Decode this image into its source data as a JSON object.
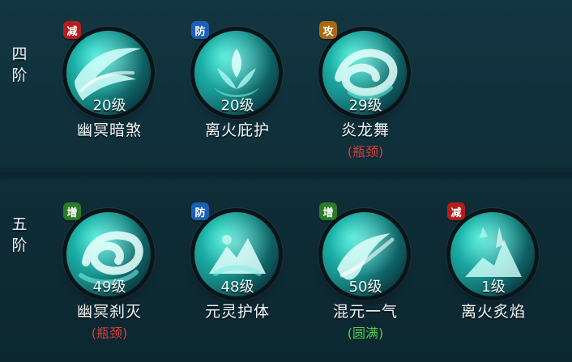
{
  "tiers": [
    {
      "label_lines": [
        "四",
        "阶"
      ]
    },
    {
      "label_lines": [
        "五",
        "阶"
      ]
    }
  ],
  "rows": [
    {
      "skills": [
        {
          "badge": "减",
          "badge_color": "#b51d1d",
          "level": "20级",
          "name": "幽冥暗煞",
          "tag": "",
          "tag_color": "",
          "icon": "swoosh-icon"
        },
        {
          "badge": "防",
          "badge_color": "#1b5fb6",
          "level": "20级",
          "name": "离火庇护",
          "tag": "",
          "tag_color": "",
          "icon": "lotus-icon"
        },
        {
          "badge": "攻",
          "badge_color": "#a86a11",
          "level": "29级",
          "name": "炎龙舞",
          "tag": "(瓶颈)",
          "tag_color": "#d24545",
          "icon": "vortex-icon"
        }
      ]
    },
    {
      "skills": [
        {
          "badge": "增",
          "badge_color": "#2a7b2a",
          "level": "49级",
          "name": "幽冥刹灭",
          "tag": "(瓶颈)",
          "tag_color": "#d24545",
          "icon": "swirl-icon"
        },
        {
          "badge": "防",
          "badge_color": "#1b5fb6",
          "level": "48级",
          "name": "元灵护体",
          "tag": "",
          "tag_color": "",
          "icon": "mountain-icon"
        },
        {
          "badge": "增",
          "badge_color": "#2a7b2a",
          "level": "50级",
          "name": "混元一气",
          "tag": "(圆满)",
          "tag_color": "#4fcf4f",
          "icon": "wave-icon"
        },
        {
          "badge": "减",
          "badge_color": "#b51d1d",
          "level": "1级",
          "name": "离火炙焰",
          "tag": "",
          "tag_color": "",
          "icon": "peak-icon"
        }
      ]
    }
  ]
}
